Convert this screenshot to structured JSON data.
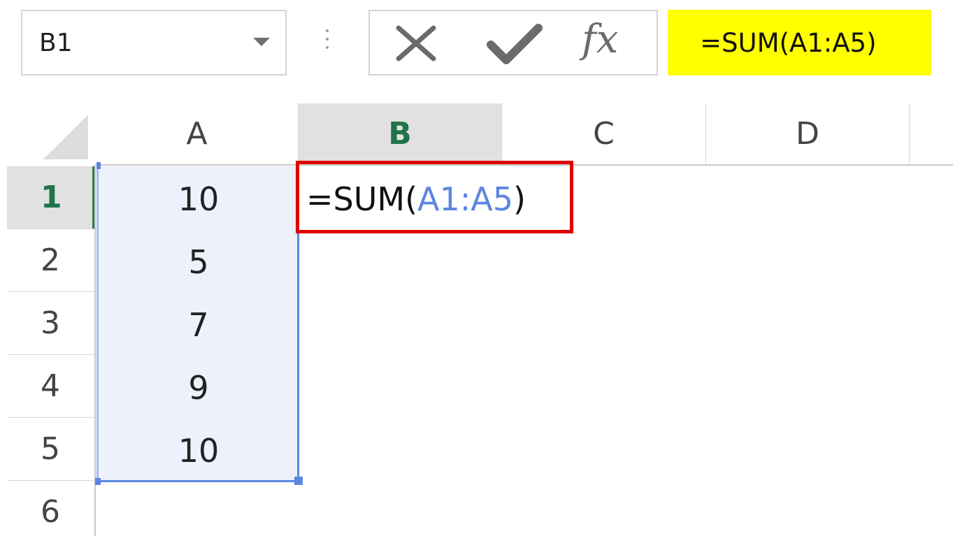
{
  "name_box": {
    "value": "B1"
  },
  "formula_bar": {
    "cancel_icon": "cancel-x-icon",
    "enter_icon": "enter-check-icon",
    "insert_function_label": "fx",
    "formula": "=SUM(A1:A5)",
    "highlight_color": "#ffff00"
  },
  "columns": [
    "A",
    "B",
    "C",
    "D"
  ],
  "selected_column": "B",
  "rows": [
    "1",
    "2",
    "3",
    "4",
    "5",
    "6"
  ],
  "selected_row": "1",
  "column_a_values": [
    "10",
    "5",
    "7",
    "9",
    "10"
  ],
  "active_cell": {
    "ref": "B1",
    "formula_prefix": "=SUM(",
    "formula_range": "A1:A5",
    "formula_suffix": ")",
    "highlight_border_color": "#e00000",
    "range_ref_color": "#5b86e0"
  }
}
